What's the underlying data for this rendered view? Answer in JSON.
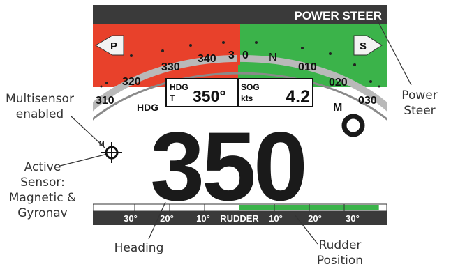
{
  "display": {
    "mode_title": "POWER STEER",
    "port_label": "P",
    "starboard_label": "S",
    "compass_labels": [
      "310",
      "320",
      "330",
      "340",
      "3",
      "0",
      "N",
      "010",
      "020",
      "030"
    ],
    "hdg_side_label": "HDG",
    "m_side_label": "M",
    "hdg_box": {
      "label_top": "HDG",
      "label_bottom": "T",
      "value": "350°"
    },
    "sog_box": {
      "label_top": "SOG",
      "label_bottom": "kts",
      "value": "4.2"
    },
    "sensor_m": "M",
    "heading_value": "350",
    "degree_symbol": "°",
    "rudder": {
      "labels": [
        "30°",
        "20°",
        "10°",
        "RUDDER",
        "10°",
        "20°",
        "30°"
      ],
      "position_fraction": 0.48,
      "direction": "starboard"
    },
    "colors": {
      "port": "#e8412b",
      "starboard": "#3bb34a",
      "header": "#3a3a3a",
      "screen_bg": "#ffffff",
      "lubber": "#e8412b"
    }
  },
  "callouts": {
    "multisensor": "Multisensor\nenabled",
    "active_sensor": "Active\nSensor:\nMagnetic &\nGyronav",
    "heading": "Heading",
    "rudder_position": "Rudder\nPosition",
    "power_steer": "Power\nSteer"
  }
}
